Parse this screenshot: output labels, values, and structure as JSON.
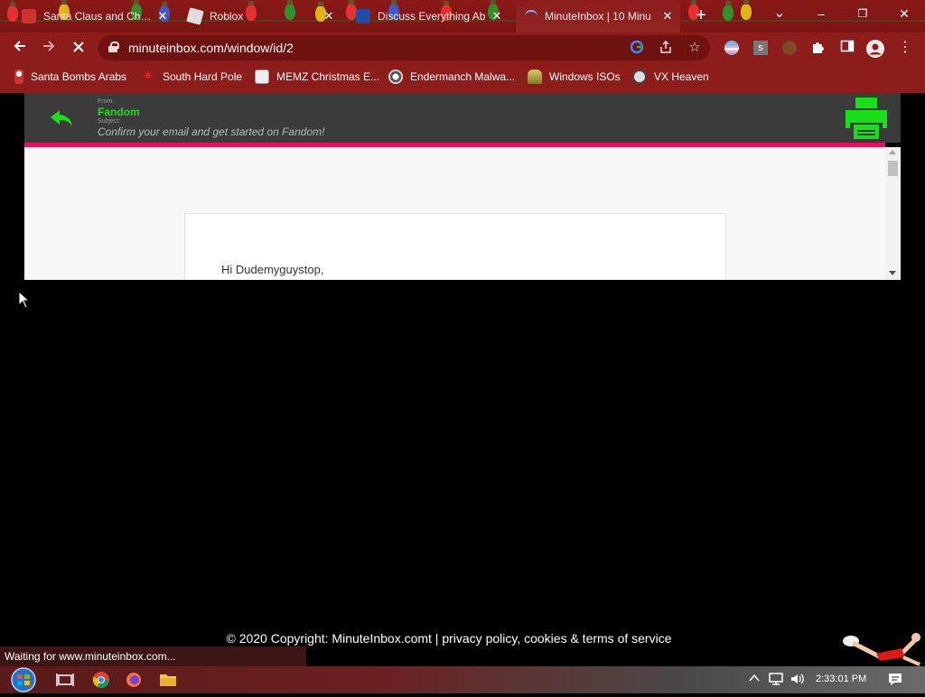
{
  "browser": {
    "tabs": [
      {
        "title": "Santa Claus and Christ",
        "active": false
      },
      {
        "title": "Roblox",
        "active": false
      },
      {
        "title": "Discuss Everything Ab",
        "active": false
      },
      {
        "title": "MinuteInbox | 10 Minu",
        "active": true
      }
    ],
    "new_tab_label": "+",
    "tab_search_label": "⌄",
    "window_controls": {
      "minimize": "–",
      "restore": "❐",
      "close": "✕"
    },
    "url": "minuteinbox.com/window/id/2",
    "bookmarks": [
      {
        "label": "Santa Bombs Arabs",
        "icon": "santa-icon"
      },
      {
        "label": "South Hard Pole",
        "icon": "red-star-icon"
      },
      {
        "label": "MEMZ Christmas E...",
        "icon": "memz-icon"
      },
      {
        "label": "Endermanch Malwa...",
        "icon": "raccoon-icon"
      },
      {
        "label": "Windows ISOs",
        "icon": "dinosaur-icon"
      },
      {
        "label": "VX Heaven",
        "icon": "vx-icon"
      }
    ],
    "status_text": "Waiting for www.minuteinbox.com..."
  },
  "mail": {
    "from_label": "From:",
    "from": "Fandom",
    "subject_label": "Subject:",
    "subject": "Confirm your email and get started on Fandom!",
    "greeting": "Hi Dudemyguystop,"
  },
  "footer": {
    "text": "© 2020 Copyright: MinuteInbox.comt | privacy policy, cookies & terms of service"
  },
  "taskbar": {
    "clock": "2:33:01 PM"
  },
  "colors": {
    "chrome_red": "#8c1d1b",
    "mail_header": "#3b3b3b",
    "accent_green": "#18e018",
    "accent_pink": "#e6125e"
  }
}
